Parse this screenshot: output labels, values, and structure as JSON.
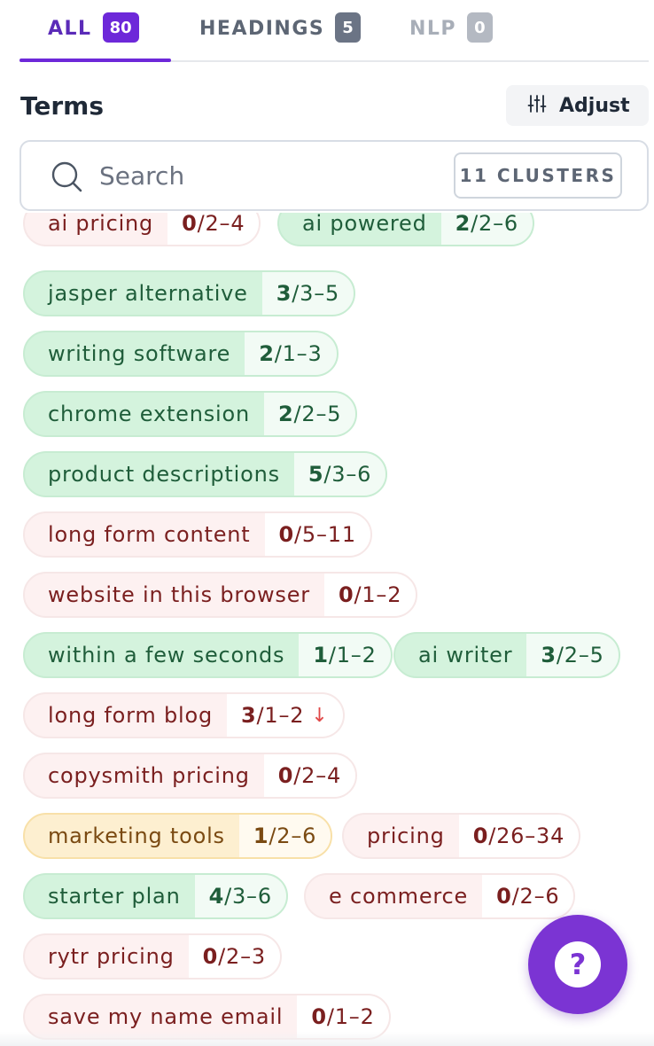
{
  "tabs": [
    {
      "label": "ALL",
      "count": "80",
      "active": true
    },
    {
      "label": "HEADINGS",
      "count": "5",
      "active": false
    },
    {
      "label": "NLP",
      "count": "0",
      "active": false
    }
  ],
  "terms_header": {
    "title": "Terms",
    "adjust_label": "Adjust",
    "adjust_icon": "sliders-icon"
  },
  "search": {
    "placeholder": "Search",
    "value": "",
    "clusters_label": "11 CLUSTERS"
  },
  "status_colors": {
    "green": "#d4f3dd",
    "red": "#fdf1f1",
    "yellow": "#fdefd0",
    "accent": "#6d28d9"
  },
  "terms": [
    {
      "name": "ai pricing",
      "used": "0",
      "range": "/2–4",
      "status": "red"
    },
    {
      "name": "ai powered",
      "used": "2",
      "range": "/2–6",
      "status": "green"
    },
    {
      "name": "jasper alternative",
      "used": "3",
      "range": "/3–5",
      "status": "green"
    },
    {
      "name": "writing software",
      "used": "2",
      "range": "/1–3",
      "status": "green"
    },
    {
      "name": "chrome extension",
      "used": "2",
      "range": "/2–5",
      "status": "green"
    },
    {
      "name": "product descriptions",
      "used": "5",
      "range": "/3–6",
      "status": "green"
    },
    {
      "name": "long form content",
      "used": "0",
      "range": "/5–11",
      "status": "red"
    },
    {
      "name": "website in this browser",
      "used": "0",
      "range": "/1–2",
      "status": "red"
    },
    {
      "name": "within a few seconds",
      "used": "1",
      "range": "/1–2",
      "status": "green"
    },
    {
      "name": "ai writer",
      "used": "3",
      "range": "/2–5",
      "status": "green"
    },
    {
      "name": "long form blog",
      "used": "3",
      "range": "/1–2",
      "status": "red",
      "indicator": "↓"
    },
    {
      "name": "copysmith pricing",
      "used": "0",
      "range": "/2–4",
      "status": "red"
    },
    {
      "name": "marketing tools",
      "used": "1",
      "range": "/2–6",
      "status": "yellow"
    },
    {
      "name": "pricing",
      "used": "0",
      "range": "/26–34",
      "status": "red"
    },
    {
      "name": "starter plan",
      "used": "4",
      "range": "/3–6",
      "status": "green"
    },
    {
      "name": "e commerce",
      "used": "0",
      "range": "/2–6",
      "status": "red"
    },
    {
      "name": "rytr pricing",
      "used": "0",
      "range": "/2–3",
      "status": "red"
    },
    {
      "name": "save my name email",
      "used": "0",
      "range": "/1–2",
      "status": "red"
    }
  ],
  "help": {
    "label": "?",
    "icon": "question-icon"
  }
}
